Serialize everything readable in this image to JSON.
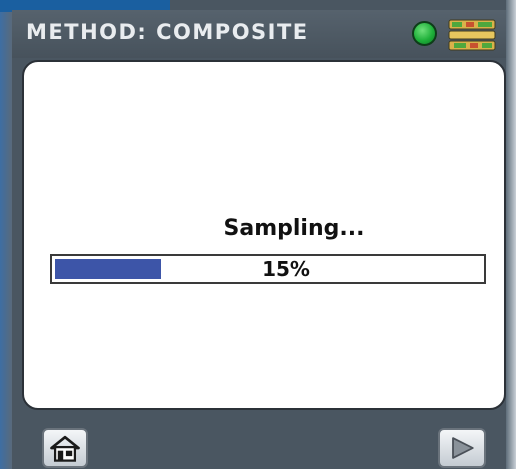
{
  "header": {
    "title": "METHOD: COMPOSITE",
    "status_indicator": "green-status-dot",
    "status_color": "#1fb03a",
    "sample_icon": "sample-tray-icon"
  },
  "main": {
    "status_text": "Sampling...",
    "progress": {
      "value_percent": 15,
      "label": "15%",
      "fill_color": "#3d55a8"
    }
  },
  "footer": {
    "home_icon": "home-icon",
    "next_icon": "play-arrow-icon"
  }
}
